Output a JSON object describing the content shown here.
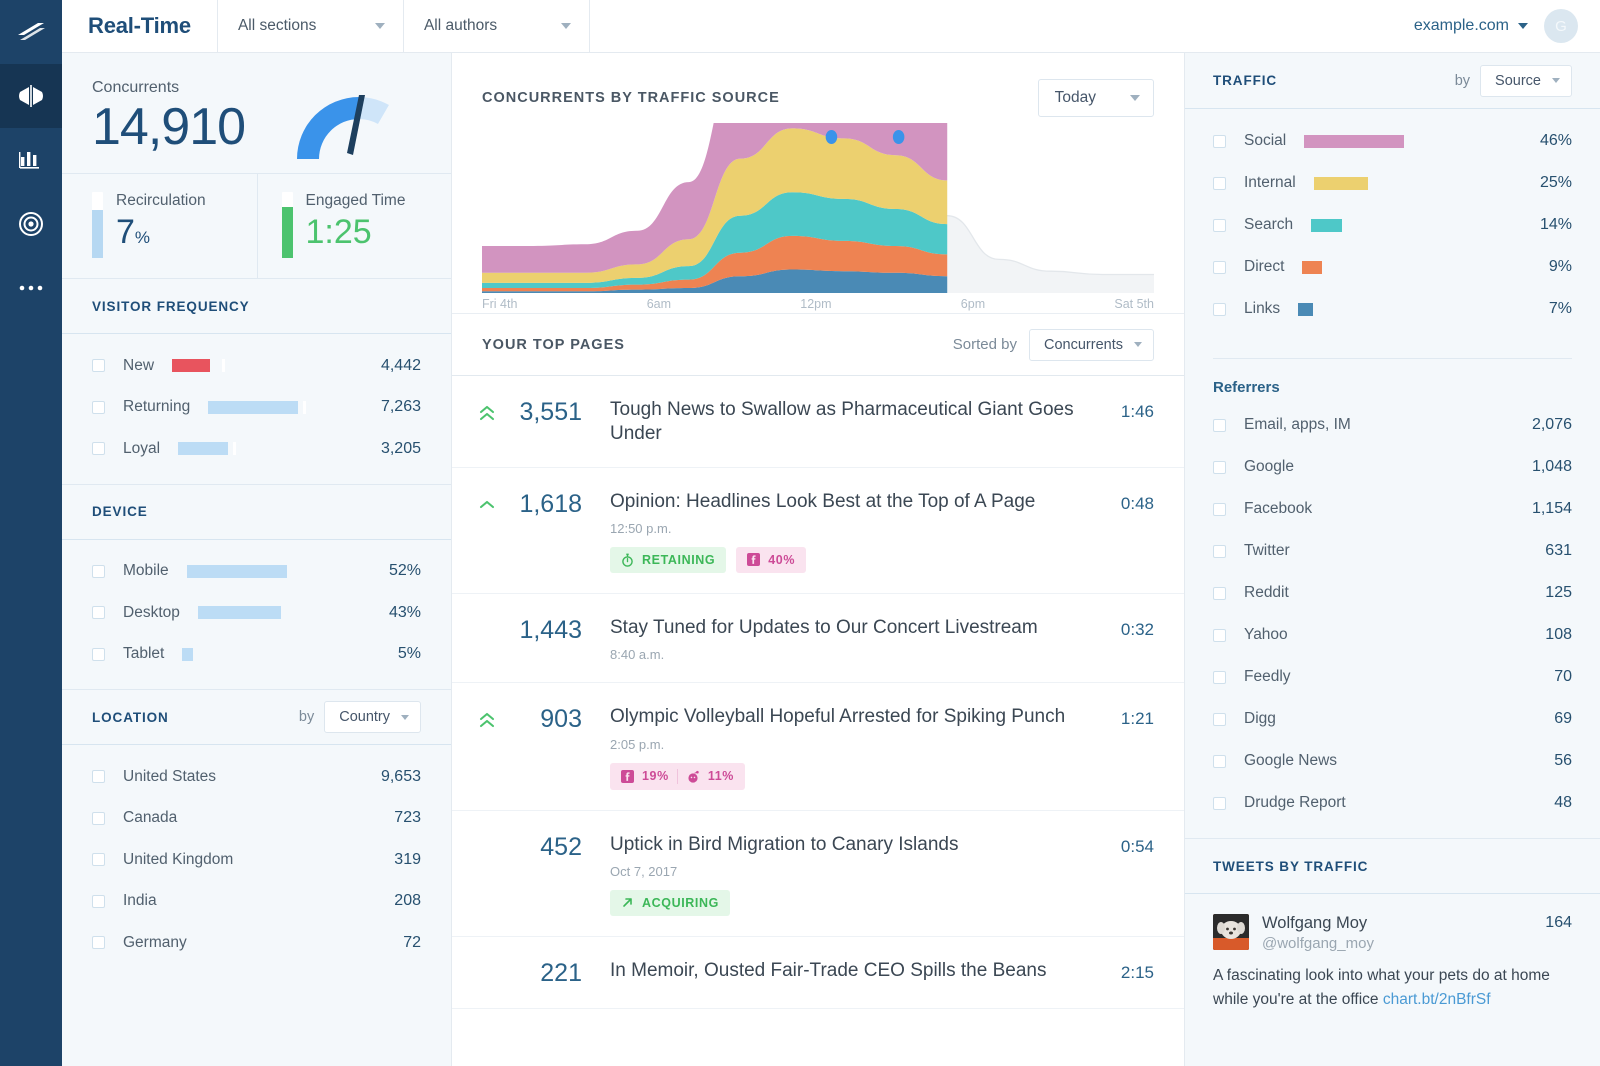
{
  "rail": {
    "items": [
      {
        "name": "logo-icon",
        "label": "Parse.ly"
      },
      {
        "name": "realtime-icon",
        "label": "Real-Time"
      },
      {
        "name": "analytics-icon",
        "label": "Analytics"
      },
      {
        "name": "goals-icon",
        "label": "Goals"
      },
      {
        "name": "more-icon",
        "label": "More"
      }
    ]
  },
  "header": {
    "title": "Real-Time",
    "sections_filter": "All sections",
    "authors_filter": "All authors",
    "domain": "example.com",
    "avatar_initial": "G"
  },
  "concurrents": {
    "label": "Concurrents",
    "value": "14,910",
    "gauge_percent": 62
  },
  "kpis": [
    {
      "name": "Recirculation",
      "value": "7",
      "unit": "%",
      "fill": 72,
      "color": "#b6d8f2"
    },
    {
      "name": "Engaged Time",
      "value": "1:25",
      "unit": "",
      "fill": 78,
      "color": "#4cc36e"
    }
  ],
  "visitor_frequency": {
    "title": "VISITOR FREQUENCY",
    "rows": [
      {
        "label": "New",
        "value": "4,442",
        "bar": 38,
        "color": "#e8545e",
        "tick": 50
      },
      {
        "label": "Returning",
        "value": "7,263",
        "bar": 90,
        "color": "#bcdcf5",
        "tick": 95
      },
      {
        "label": "Loyal",
        "value": "3,205",
        "bar": 50,
        "color": "#bcdcf5",
        "tick": 55
      }
    ]
  },
  "device": {
    "title": "DEVICE",
    "rows": [
      {
        "label": "Mobile",
        "value": "52%",
        "bar": 100,
        "color": "#bcdcf5"
      },
      {
        "label": "Desktop",
        "value": "43%",
        "bar": 83,
        "color": "#bcdcf5"
      },
      {
        "label": "Tablet",
        "value": "5%",
        "bar": 11,
        "color": "#bcdcf5"
      }
    ]
  },
  "location": {
    "title": "LOCATION",
    "by_label": "by",
    "by_value": "Country",
    "rows": [
      {
        "label": "United States",
        "value": "9,653"
      },
      {
        "label": "Canada",
        "value": "723"
      },
      {
        "label": "United Kingdom",
        "value": "319"
      },
      {
        "label": "India",
        "value": "208"
      },
      {
        "label": "Germany",
        "value": "72"
      }
    ]
  },
  "chart_panel": {
    "title": "CONCURRENTS BY TRAFFIC SOURCE",
    "range_value": "Today"
  },
  "top_pages": {
    "title": "YOUR TOP PAGES",
    "sort_label": "Sorted by",
    "sort_value": "Concurrents",
    "rows": [
      {
        "trend": "double-up",
        "count": "3,551",
        "title": "Tough News to Swallow as Pharmaceutical Giant Goes Under",
        "time": "",
        "duration": "1:46",
        "badges": []
      },
      {
        "trend": "up",
        "count": "1,618",
        "title": "Opinion: Headlines Look Best at the Top of A Page",
        "time": "12:50 p.m.",
        "duration": "0:48",
        "badges": [
          {
            "kind": "green",
            "icon": "stopwatch-icon",
            "text": "RETAINING"
          },
          {
            "kind": "pink",
            "icon": "facebook-icon",
            "text": "40%"
          }
        ]
      },
      {
        "trend": "none",
        "count": "1,443",
        "title": "Stay Tuned for Updates to Our Concert Livestream",
        "time": "8:40 a.m.",
        "duration": "0:32",
        "badges": []
      },
      {
        "trend": "double-up",
        "count": "903",
        "title": "Olympic Volleyball Hopeful Arrested for Spiking Punch",
        "time": "2:05 p.m.",
        "duration": "1:21",
        "badges": [
          {
            "kind": "pink",
            "icon": "facebook-icon",
            "text": "19%",
            "icon2": "reddit-icon",
            "text2": "11%"
          }
        ]
      },
      {
        "trend": "none",
        "count": "452",
        "title": "Uptick in Bird Migration to Canary Islands",
        "time": "Oct 7, 2017",
        "duration": "0:54",
        "badges": [
          {
            "kind": "green",
            "icon": "arrow-up-right-icon",
            "text": "ACQUIRING"
          }
        ]
      },
      {
        "trend": "none",
        "count": "221",
        "title": "In Memoir, Ousted Fair-Trade CEO Spills the Beans",
        "time": "",
        "duration": "2:15",
        "badges": []
      }
    ]
  },
  "traffic": {
    "title": "TRAFFIC",
    "by_label": "by",
    "by_value": "Source",
    "rows": [
      {
        "label": "Social",
        "value": "46%",
        "bar": 100,
        "color": "#d294c0"
      },
      {
        "label": "Internal",
        "value": "25%",
        "bar": 54,
        "color": "#ecd06f"
      },
      {
        "label": "Search",
        "value": "14%",
        "bar": 31,
        "color": "#4ec8c8"
      },
      {
        "label": "Direct",
        "value": "9%",
        "bar": 20,
        "color": "#ee8352"
      },
      {
        "label": "Links",
        "value": "7%",
        "bar": 15,
        "color": "#4a8ab5"
      }
    ]
  },
  "referrers": {
    "title": "Referrers",
    "rows": [
      {
        "label": "Email, apps, IM",
        "value": "2,076"
      },
      {
        "label": "Google",
        "value": "1,048"
      },
      {
        "label": "Facebook",
        "value": "1,154"
      },
      {
        "label": "Twitter",
        "value": "631"
      },
      {
        "label": "Reddit",
        "value": "125"
      },
      {
        "label": "Yahoo",
        "value": "108"
      },
      {
        "label": "Feedly",
        "value": "70"
      },
      {
        "label": "Digg",
        "value": "69"
      },
      {
        "label": "Google News",
        "value": "56"
      },
      {
        "label": "Drudge Report",
        "value": "48"
      }
    ]
  },
  "tweets": {
    "title": "TWEETS BY TRAFFIC",
    "items": [
      {
        "name": "Wolfgang Moy",
        "handle": "@wolfgang_moy",
        "count": "164",
        "text": "A fascinating look into what your pets do at home while you're at the office ",
        "link": "chart.bt/2nBfrSf"
      }
    ]
  },
  "chart_data": {
    "type": "area",
    "title": "CONCURRENTS BY TRAFFIC SOURCE",
    "xlabel": "",
    "ylabel": "Concurrents",
    "grid": false,
    "legend_position": "none",
    "x": [
      "Fri 4th",
      "6am",
      "12pm",
      "6pm",
      "Sat 5th"
    ],
    "tick_labels": [
      "Fri 4th",
      "6am",
      "12pm",
      "6pm",
      "Sat 5th"
    ],
    "series": [
      {
        "name": "Links",
        "color": "#4a8ab5",
        "values": [
          1,
          1,
          1,
          2,
          3,
          10,
          14,
          13,
          12,
          10,
          2,
          1,
          1,
          1
        ]
      },
      {
        "name": "Direct",
        "color": "#ee8352",
        "values": [
          2,
          2,
          2,
          3,
          5,
          14,
          20,
          18,
          16,
          13,
          2,
          2,
          1,
          1
        ]
      },
      {
        "name": "Search",
        "color": "#4ec8c8",
        "values": [
          3,
          3,
          3,
          4,
          8,
          22,
          26,
          25,
          22,
          18,
          3,
          2,
          2,
          2
        ]
      },
      {
        "name": "Internal",
        "color": "#ecd06f",
        "values": [
          6,
          6,
          6,
          8,
          16,
          34,
          38,
          36,
          32,
          26,
          5,
          4,
          3,
          3
        ]
      },
      {
        "name": "Social",
        "color": "#d294c0",
        "values": [
          16,
          16,
          17,
          20,
          34,
          62,
          72,
          68,
          58,
          44,
          9,
          6,
          5,
          5
        ]
      }
    ],
    "projection": {
      "name": "Projected",
      "color": "#eef1f4",
      "values": [
        18,
        18,
        19,
        22,
        36,
        66,
        76,
        70,
        60,
        46,
        20,
        13,
        11,
        11
      ]
    },
    "markers": [
      {
        "x": 0.52,
        "label": ""
      },
      {
        "x": 0.62,
        "label": ""
      }
    ]
  }
}
